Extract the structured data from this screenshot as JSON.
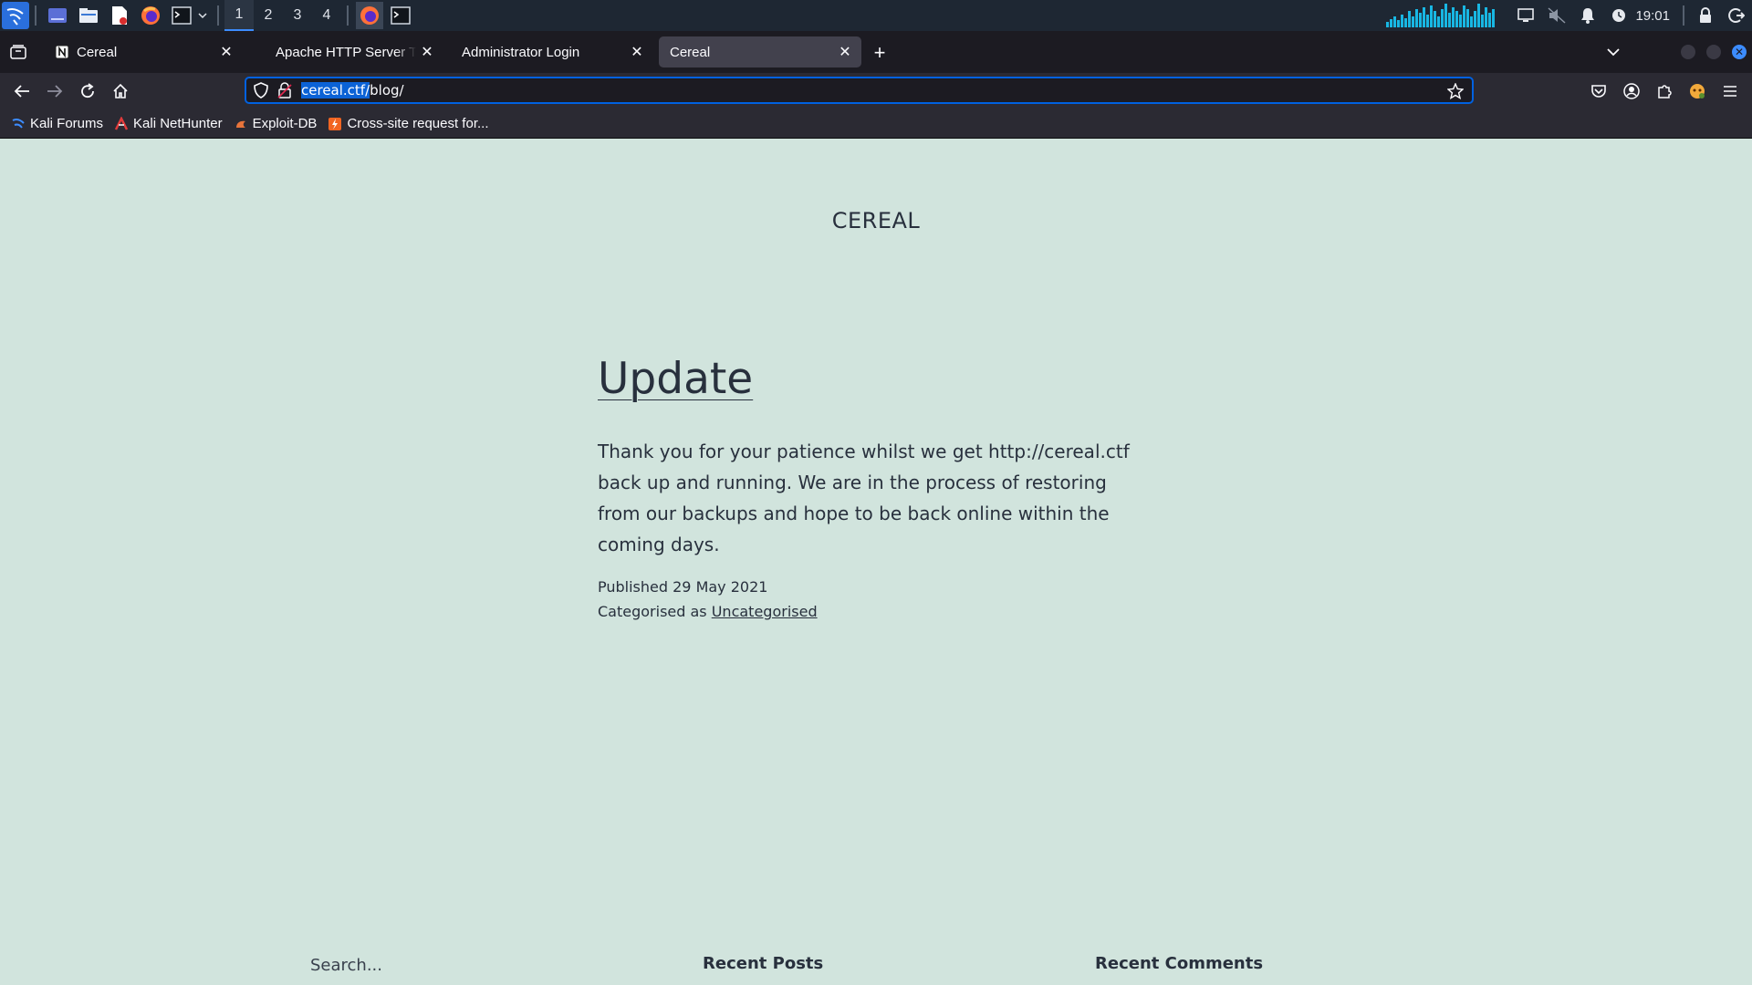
{
  "taskbar": {
    "workspaces": [
      "1",
      "2",
      "3",
      "4"
    ],
    "active_workspace": "1",
    "clock": "19:01",
    "accent_color": "#3c8cff"
  },
  "tabs": [
    {
      "title": "Cereal",
      "selected": false
    },
    {
      "title": "Apache HTTP Server Test",
      "selected": false
    },
    {
      "title": "Administrator Login",
      "selected": false
    },
    {
      "title": "Cereal",
      "selected": true
    }
  ],
  "address_bar": {
    "host_highlighted": "cereal.ctf/",
    "path": "blog/"
  },
  "bookmarks": [
    {
      "label": "Kali Forums",
      "icon": "kali-forums-icon"
    },
    {
      "label": "Kali NetHunter",
      "icon": "nethunter-icon"
    },
    {
      "label": "Exploit-DB",
      "icon": "exploit-db-icon"
    },
    {
      "label": "Cross-site request for...",
      "icon": "csrf-icon"
    }
  ],
  "site": {
    "title": "CEREAL",
    "background_color": "#d1e4dd"
  },
  "post": {
    "title": "Update",
    "content": "Thank you for your patience whilst we get http://cereal.ctf back up and running. We are in the process of restoring from our backups and hope to be back online within the coming days.",
    "published": "Published 29 May 2021",
    "categorised_prefix": "Categorised as",
    "category": "Uncategorised"
  },
  "widgets": {
    "search_placeholder": "Search...",
    "recent_posts": "Recent Posts",
    "recent_comments": "Recent Comments"
  }
}
